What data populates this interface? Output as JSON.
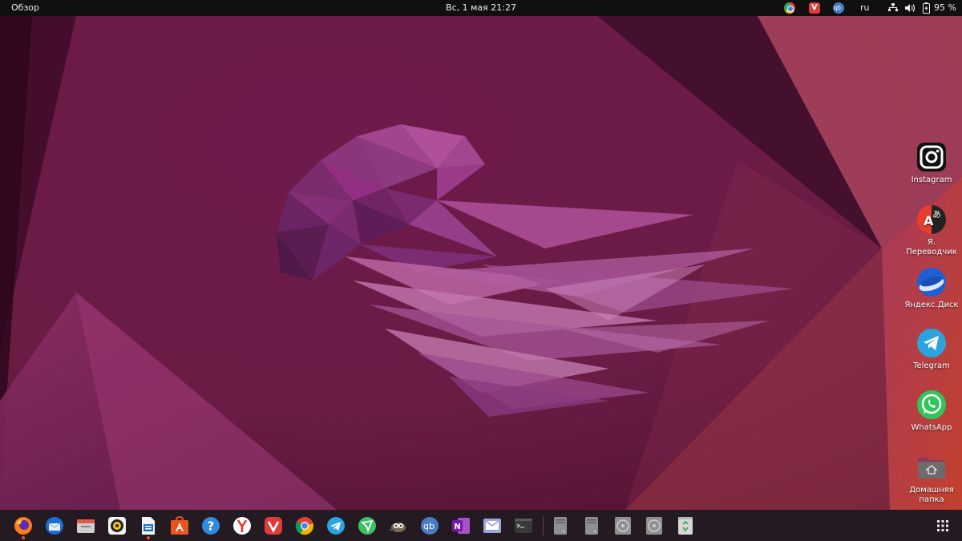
{
  "topbar": {
    "activities": "Обзор",
    "clock": "Вс, 1 мая  21:27",
    "language": "ru",
    "battery": "95 %",
    "tray_icons": [
      "chrome-icon",
      "vivaldi-icon",
      "qbittorrent-icon",
      "network-icon",
      "volume-icon",
      "battery-icon"
    ]
  },
  "desktop": {
    "icons": [
      {
        "name": "instagram",
        "label": "Instagram",
        "icon": "instagram-icon"
      },
      {
        "name": "yandex-translate",
        "label": "Я. Переводчик",
        "icon": "translate-icon"
      },
      {
        "name": "yandex-disk",
        "label": "Яндекс.Диск",
        "icon": "yandex-disk-icon"
      },
      {
        "name": "telegram",
        "label": "Telegram",
        "icon": "telegram-icon"
      },
      {
        "name": "whatsapp",
        "label": "WhatsApp",
        "icon": "whatsapp-icon"
      },
      {
        "name": "home-folder",
        "label": "Домашняя папка",
        "icon": "home-folder-icon"
      }
    ]
  },
  "dock": {
    "items": [
      {
        "name": "firefox",
        "icon": "firefox-icon",
        "running": true
      },
      {
        "name": "thunderbird",
        "icon": "thunderbird-icon",
        "running": false
      },
      {
        "name": "files",
        "icon": "files-icon",
        "running": false
      },
      {
        "name": "rhythmbox",
        "icon": "rhythmbox-icon",
        "running": false
      },
      {
        "name": "writer",
        "icon": "writer-icon",
        "running": true
      },
      {
        "name": "software",
        "icon": "software-icon",
        "running": false
      },
      {
        "name": "help",
        "icon": "help-icon",
        "running": false
      },
      {
        "name": "yandex-browser",
        "icon": "yandex-browser-icon",
        "running": false
      },
      {
        "name": "vivaldi",
        "icon": "vivaldi-icon",
        "running": false
      },
      {
        "name": "chrome",
        "icon": "chrome-icon",
        "running": false
      },
      {
        "name": "telegram",
        "icon": "telegram-icon",
        "running": false
      },
      {
        "name": "vpn",
        "icon": "vpn-icon",
        "running": false
      },
      {
        "name": "gimp",
        "icon": "gimp-icon",
        "running": false
      },
      {
        "name": "qbittorrent",
        "icon": "qbittorrent-icon",
        "running": false
      },
      {
        "name": "onenote",
        "icon": "onenote-icon",
        "running": false
      },
      {
        "name": "mail",
        "icon": "mail-icon",
        "running": false
      },
      {
        "name": "terminal",
        "icon": "terminal-icon",
        "running": false
      },
      {
        "name": "drive-1",
        "icon": "drive-icon",
        "running": false
      },
      {
        "name": "drive-2",
        "icon": "drive-icon",
        "running": false
      },
      {
        "name": "disc-1",
        "icon": "disc-icon",
        "running": false
      },
      {
        "name": "disc-2",
        "icon": "disc-icon",
        "running": false
      },
      {
        "name": "trash",
        "icon": "trash-icon",
        "running": false
      },
      {
        "name": "app-grid",
        "icon": "app-grid-icon",
        "running": false
      }
    ]
  },
  "colors": {
    "accent": "#e95420",
    "topbar": "#101010",
    "dock": "#241a21"
  }
}
